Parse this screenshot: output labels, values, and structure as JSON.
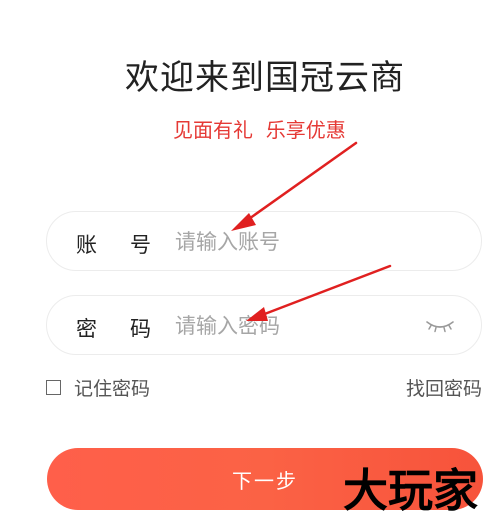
{
  "header": {
    "title": "欢迎来到国冠云商",
    "subtitle": "见面有礼  乐享优惠"
  },
  "form": {
    "account": {
      "label_first": "账",
      "label_second": "号",
      "placeholder": "请输入账号",
      "value": ""
    },
    "password": {
      "label_first": "密",
      "label_second": "码",
      "placeholder": "请输入密码",
      "value": "",
      "toggle_icon": "eye-closed-icon"
    },
    "remember_label": "记住密码",
    "remember_checked": false,
    "forgot_label": "找回密码"
  },
  "actions": {
    "next_label": "下一步"
  },
  "watermark": {
    "text": "大玩家"
  },
  "colors": {
    "accent": "#fb6245",
    "subtitle": "#e53935",
    "annotation_arrow": "#e02020"
  }
}
